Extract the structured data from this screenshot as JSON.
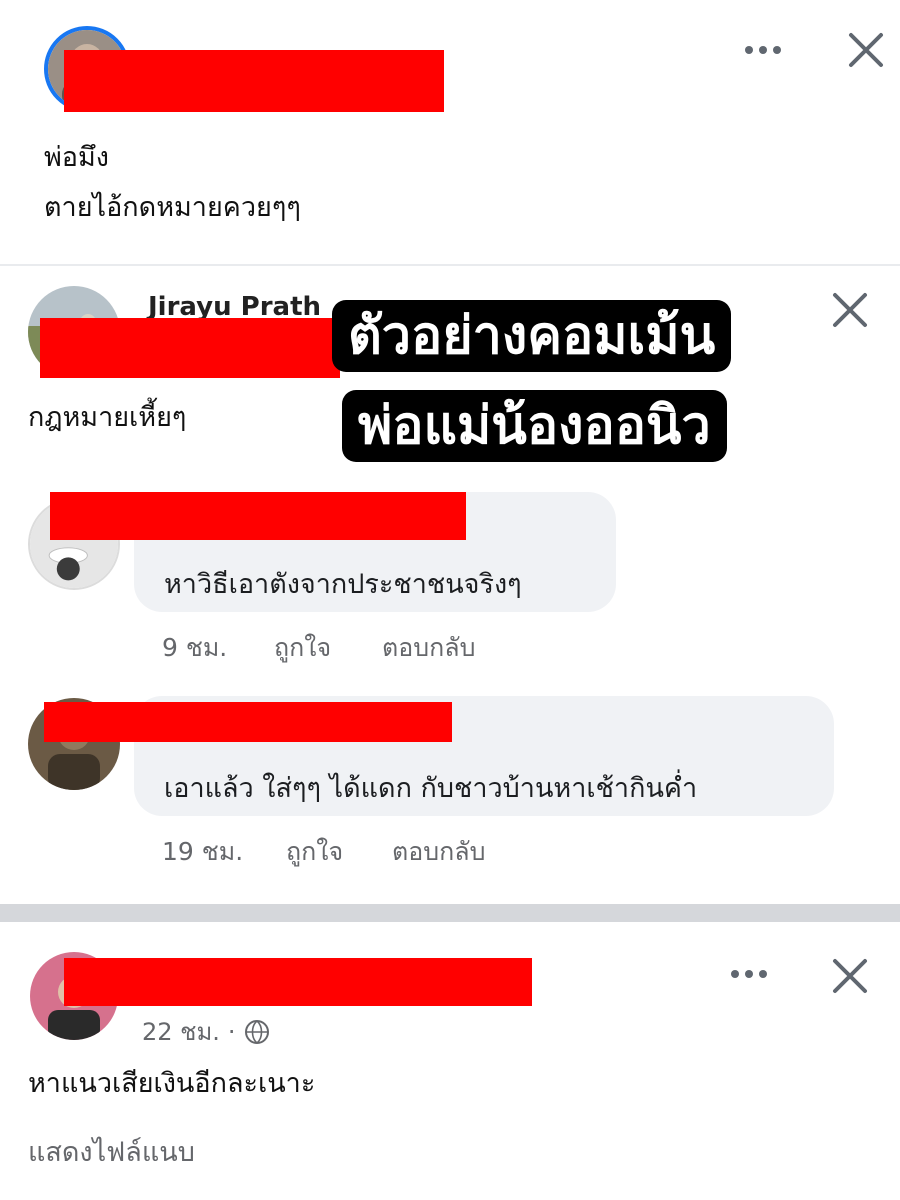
{
  "post1": {
    "line1": "พ่อมึง",
    "line2": "ตายไอ้กดหมายควยๆๆ",
    "more_icon": "more-horizontal-icon",
    "close_icon": "close-icon"
  },
  "post2": {
    "name_peek": "Jirayu Prath",
    "text": "กฎหมายเหี้ยๆ",
    "close_icon": "close-icon"
  },
  "overlay": {
    "line1": "ตัวอย่างคอมเม้น",
    "line2": "พ่อแม่น้องออนิว"
  },
  "comments": [
    {
      "text": "หาวิธีเอาตังจากประชาชนจริงๆ",
      "time": "9 ชม.",
      "like": "ถูกใจ",
      "reply": "ตอบกลับ"
    },
    {
      "text": "เอาแล้ว ใส่ๆๆ ได้แดก กับชาวบ้านหาเช้ากินค่ำ",
      "time": "19 ชม.",
      "like": "ถูกใจ",
      "reply": "ตอบกลับ"
    }
  ],
  "post4": {
    "time": "22 ชม.",
    "separator": "·",
    "privacy_icon": "globe-icon",
    "text": "หาแนวเสียเงินอีกละเนาะ",
    "link": "แสดงไฟล์แนบ",
    "more_icon": "more-horizontal-icon",
    "close_icon": "close-icon"
  },
  "colors": {
    "redaction": "#ff0000",
    "bubble": "#f0f2f5",
    "muted_text": "#65676b",
    "overlay_bg": "#000000",
    "overlay_text": "#ffffff",
    "thick_divider": "#d5d7db"
  }
}
